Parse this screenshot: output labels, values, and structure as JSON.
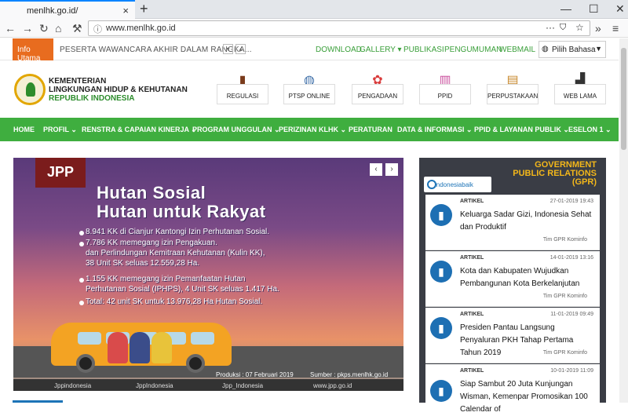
{
  "browser": {
    "tab_title": "menlhk.go.id/",
    "url": "www.menlhk.go.id",
    "new_tab": "+",
    "close_tab": "×"
  },
  "infobar": {
    "tag": "Info Utama",
    "ticker": "PESERTA WAWANCARA AKHIR DALAM RANGKA...",
    "links": [
      "DOWNLOAD",
      "GALLERY ▾",
      "PUBLIKASI",
      "PENGUMUMAN",
      "WEBMAIL"
    ],
    "language": "Pilih Bahasa"
  },
  "logo": {
    "line1": "KEMENTERIAN",
    "line2": "LINGKUNGAN HIDUP & KEHUTANAN",
    "line3": "REPUBLIK INDONESIA"
  },
  "quicklinks": [
    "REGULASI",
    "PTSP ONLINE",
    "PENGADAAN",
    "PPID",
    "PERPUSTAKAAN",
    "WEB LAMA"
  ],
  "menu": [
    "HOME",
    "PROFIL ⌄",
    "RENSTRA & CAPAIAN KINERJA ⌄",
    "PROGRAM UNGGULAN ⌄",
    "PERIZINAN KLHK ⌄",
    "PERATURAN",
    "DATA & INFORMASI ⌄",
    "PPID & LAYANAN PUBLIK ⌄",
    "ESELON 1 ⌄"
  ],
  "slider": {
    "badge": "JPP",
    "title1": "Hutan Sosial",
    "title2": "Hutan untuk Rakyat",
    "b1": "8.941 KK di Cianjur Kantongi Izin Perhutanan Sosial.",
    "b2a": "7.786 KK memegang izin Pengakuan.",
    "b2b": "dan Perlindungan Kemitraan Kehutanan (Kulin KK),",
    "b2c": "38 Unit SK seluas 12.559,28 Ha.",
    "b3a": "1.155 KK memegang izin Pemanfaatan Hutan",
    "b3b": "Perhutanan Sosial (IPHPS), 4 Unit SK seluas 1.417 Ha.",
    "b4": "Total: 42 unit SK untuk 13.976,28 Ha Hutan Sosial.",
    "produksi": "Produksi : 07 Februari 2019",
    "sumber": "Sumber : pkps.menlhk.go.id",
    "credits": [
      "Jppindonesia",
      "JppIndonesia",
      "Jpp_Indonesia",
      "www.jpp.go.id"
    ]
  },
  "gpr": {
    "title1": "GOVERNMENT",
    "title2": "PUBLIC RELATIONS",
    "title3": "(GPR)",
    "brand": "indonesiabaik",
    "articles": [
      {
        "label": "ARTIKEL",
        "date": "27-01-2019 19:43",
        "title": "Keluarga Sadar Gizi, Indonesia Sehat dan Produktif",
        "source": "Tim GPR Kominfo"
      },
      {
        "label": "ARTIKEL",
        "date": "14-01-2019 13:16",
        "title": "Kota dan Kabupaten Wujudkan Pembangunan Kota Berkelanjutan",
        "source": "Tim GPR Kominfo"
      },
      {
        "label": "ARTIKEL",
        "date": "11-01-2019 09:49",
        "title": "Presiden Pantau Langsung Penyaluran PKH Tahap Pertama Tahun 2019",
        "source": "Tim GPR Kominfo"
      },
      {
        "label": "ARTIKEL",
        "date": "10-01-2019 11:09",
        "title": "Siap Sambut 20 Juta Kunjungan Wisman, Kemenpar Promosikan 100 Calendar of",
        "source": ""
      }
    ]
  }
}
